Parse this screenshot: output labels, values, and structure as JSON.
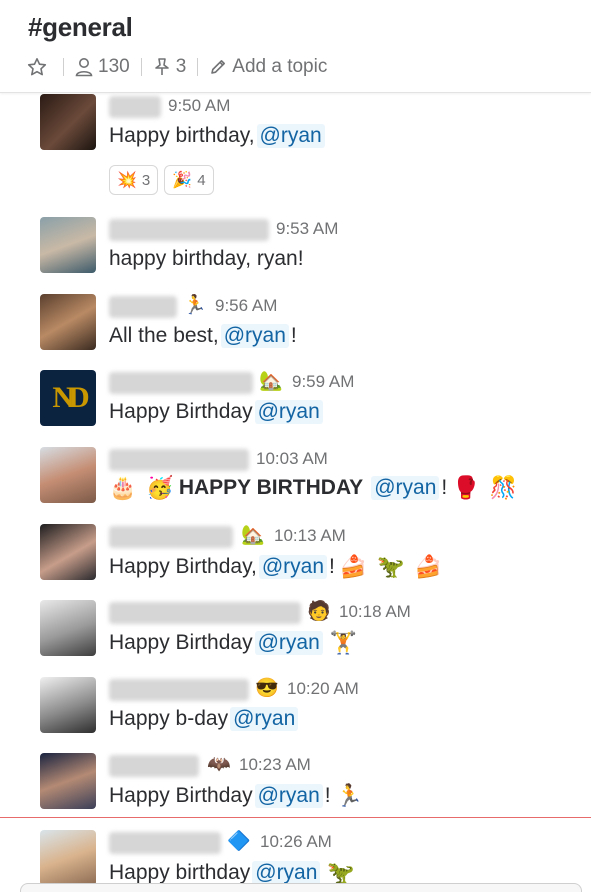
{
  "channel": {
    "title": "#general",
    "members_count": "130",
    "pinned_count": "3",
    "add_topic_label": "Add a topic"
  },
  "messages": [
    {
      "time": "9:50 AM",
      "text_before": "Happy birthday,",
      "mention": "@ryan",
      "text_after": "",
      "status_icon": "",
      "emojis": []
    },
    {
      "time": "9:53 AM",
      "text_before": "happy birthday, ryan!",
      "mention": "",
      "text_after": "",
      "status_icon": "",
      "emojis": []
    },
    {
      "time": "9:56 AM",
      "text_before": "All the best,",
      "mention": "@ryan",
      "text_after": "!",
      "status_icon": "🏃",
      "emojis": []
    },
    {
      "time": "9:59 AM",
      "text_before": "Happy Birthday",
      "mention": "@ryan",
      "text_after": "",
      "status_icon": "🏡",
      "emojis": []
    },
    {
      "time": "10:03 AM",
      "text_before": "",
      "bold_text": "HAPPY BIRTHDAY",
      "mention": "@ryan",
      "text_after": "!",
      "status_icon": "",
      "emojis_before": [
        "🎂",
        "🥳"
      ],
      "emojis": [
        "🥊",
        "🎊"
      ]
    },
    {
      "time": "10:13 AM",
      "text_before": "Happy Birthday,",
      "mention": "@ryan",
      "text_after": "!",
      "status_icon": "🏡",
      "emojis": [
        "🍰",
        "🦖",
        "🍰"
      ]
    },
    {
      "time": "10:18 AM",
      "text_before": "Happy Birthday",
      "mention": "@ryan",
      "text_after": "",
      "status_icon": "🧑",
      "emojis": [
        "🏋"
      ]
    },
    {
      "time": "10:20 AM",
      "text_before": "Happy b-day",
      "mention": "@ryan",
      "text_after": "",
      "status_icon": "😎",
      "emojis": []
    },
    {
      "time": "10:23 AM",
      "text_before": "Happy Birthday",
      "mention": "@ryan",
      "text_after": "!",
      "status_icon": "🦇",
      "emojis": [
        "🏃"
      ]
    },
    {
      "time": "10:26 AM",
      "text_before": "Happy birthday",
      "mention": "@ryan",
      "text_after": "",
      "status_icon": "🔷",
      "emojis": [
        "🦖"
      ]
    }
  ],
  "reactions": [
    {
      "emoji": "💥",
      "count": "3"
    },
    {
      "emoji": "🎉",
      "count": "4"
    }
  ],
  "colors": {
    "mention_bg": "#eaf5fc",
    "mention_text": "#1264a3",
    "new_message_line": "#e86b6b"
  }
}
